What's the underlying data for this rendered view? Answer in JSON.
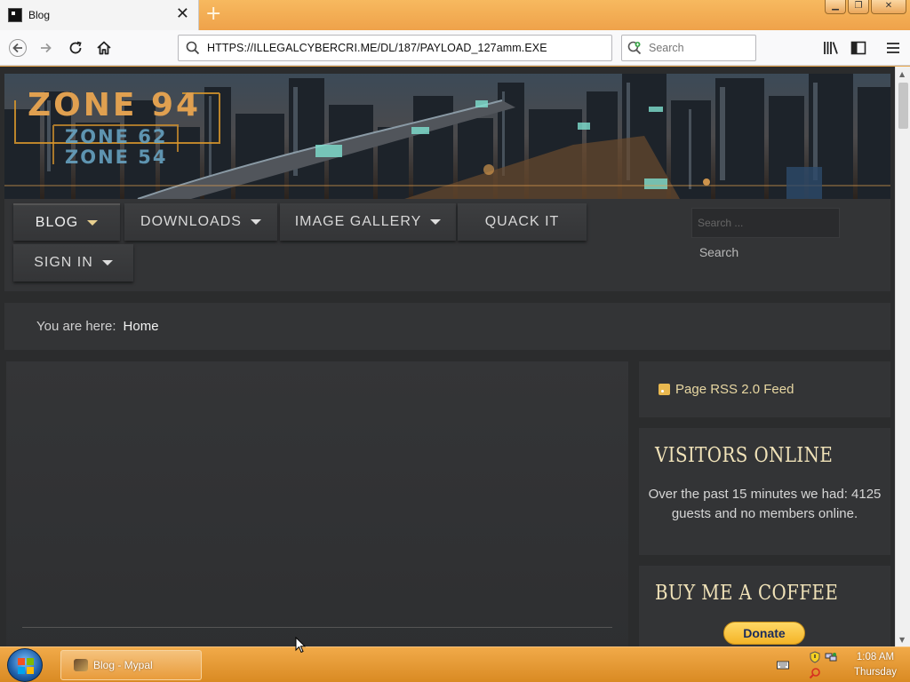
{
  "browser": {
    "tab_title": "Blog",
    "new_tab_symbol": "+",
    "close_tab_symbol": "✕",
    "url": "HTTPS://ILLEGALCYBERCRI.ME/DL/187/PAYLOAD_127amm.EXE",
    "search_placeholder": "Search",
    "icons": [
      "back-arrow-icon",
      "forward-arrow-icon",
      "reload-icon",
      "home-icon",
      "library-icon",
      "sidebar-icon",
      "hamburger-menu-icon"
    ]
  },
  "window_controls": {
    "minimize": "▁",
    "restore": "❐",
    "close": "✕"
  },
  "site": {
    "logo_text": "ZONE 94",
    "logo_sub_1": "ZONE 62",
    "logo_sub_2": "ZONE 54",
    "menu": [
      {
        "label": "BLOG",
        "has_dropdown": true,
        "active": true
      },
      {
        "label": "DOWNLOADS",
        "has_dropdown": true
      },
      {
        "label": "IMAGE GALLERY",
        "has_dropdown": true
      },
      {
        "label": "QUACK IT",
        "has_dropdown": false
      },
      {
        "label": "SIGN IN",
        "has_dropdown": true
      }
    ],
    "search_placeholder": "Search ...",
    "search_button": "Search",
    "breadcrumb_prefix": "You are here:",
    "breadcrumb_home": "Home",
    "rss_label": "Page RSS 2.0 Feed",
    "visitors_title": "VISITORS ONLINE",
    "visitors_text": "Over the past 15 minutes we had: 4125 guests and no members online.",
    "coffee_title": "BUY ME A COFFEE",
    "donate_label": "Donate"
  },
  "taskbar": {
    "task_label": "Blog - Mypal",
    "time": "1:08 AM",
    "day": "Thursday"
  },
  "colors": {
    "page_bg": "#2b2c2d",
    "panel_bg": "#333436",
    "heading_gold": "#f0e2b8",
    "rss_gold": "#e8d7a2",
    "logo_orange": "#e0a050",
    "logo_cyan": "#6aa8c8",
    "taskbar_orange": "#e89b3b",
    "donate_yellow": "#f4b427"
  }
}
